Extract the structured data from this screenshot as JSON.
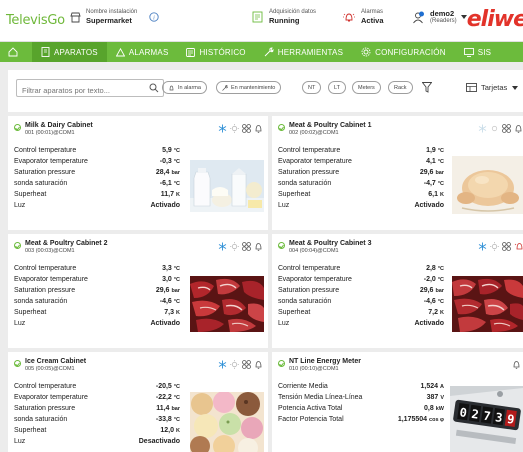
{
  "header": {
    "logo": "TelevisGo",
    "installation_label": "Nombre instalación",
    "installation_value": "Supermarket",
    "acquisition_label": "Adquisición datos",
    "acquisition_value": "Running",
    "alarms_label": "Alarmas",
    "alarms_value": "Activa",
    "user_name": "demo2",
    "user_role": "(Readers)",
    "brand": "eliwe"
  },
  "nav": {
    "home_icon": "home-icon",
    "items": [
      {
        "label": "APARATOS",
        "icon": "devices-icon",
        "active": true
      },
      {
        "label": "ALARMAS",
        "icon": "alarm-icon"
      },
      {
        "label": "HISTÓRICO",
        "icon": "history-icon"
      },
      {
        "label": "HERRAMIENTAS",
        "icon": "tools-icon"
      },
      {
        "label": "CONFIGURACIÓN",
        "icon": "gear-icon"
      },
      {
        "label": "SIS",
        "icon": "monitor-icon"
      }
    ]
  },
  "toolbar": {
    "search_placeholder": "Filtrar aparatos por texto...",
    "filters": [
      "In alarma",
      "En mantenimiento",
      "NT",
      "LT",
      "Meters",
      "Rack"
    ],
    "view_label": "Tarjetas"
  },
  "colors": {
    "accent": "#6cbb3c",
    "nav_active": "#58a42c",
    "brand": "#e2332a"
  },
  "cards": [
    {
      "title": "Milk & Dairy Cabinet",
      "id": "001 (00:01)@COM1",
      "image": "dairy",
      "rows": [
        {
          "label": "Control temperature",
          "value": "5,9",
          "unit": "°C"
        },
        {
          "label": "Evaporator temperature",
          "value": "-0,3",
          "unit": "°C"
        },
        {
          "label": "Saturation pressure",
          "value": "28,4",
          "unit": "bar"
        },
        {
          "label": "sonda saturación",
          "value": "-6,1",
          "unit": "°C"
        },
        {
          "label": "Superheat",
          "value": "11,7",
          "unit": "K"
        },
        {
          "label": "Luz",
          "value": "Activado",
          "unit": ""
        }
      ]
    },
    {
      "title": "Meat & Poultry Cabinet 1",
      "id": "002 (00:02)@COM1",
      "image": "chicken",
      "rows": [
        {
          "label": "Control temperature",
          "value": "1,9",
          "unit": "°C"
        },
        {
          "label": "Evaporator temperature",
          "value": "4,1",
          "unit": "°C"
        },
        {
          "label": "Saturation pressure",
          "value": "29,6",
          "unit": "bar"
        },
        {
          "label": "sonda saturación",
          "value": "-4,7",
          "unit": "°C"
        },
        {
          "label": "Superheat",
          "value": "6,1",
          "unit": "K"
        },
        {
          "label": "Luz",
          "value": "Activado",
          "unit": ""
        }
      ]
    },
    {
      "title": "Meat & Poultry Cabinet 2",
      "id": "003 (00:03)@COM1",
      "image": "meat",
      "rows": [
        {
          "label": "Control temperature",
          "value": "3,3",
          "unit": "°C"
        },
        {
          "label": "Evaporator temperature",
          "value": "3,0",
          "unit": "°C"
        },
        {
          "label": "Saturation pressure",
          "value": "29,6",
          "unit": "bar"
        },
        {
          "label": "sonda saturación",
          "value": "-4,6",
          "unit": "°C"
        },
        {
          "label": "Superheat",
          "value": "7,3",
          "unit": "K"
        },
        {
          "label": "Luz",
          "value": "Activado",
          "unit": ""
        }
      ]
    },
    {
      "title": "Meat & Poultry Cabinet 3",
      "id": "004 (00:04)@COM1",
      "image": "meat",
      "rows": [
        {
          "label": "Control temperature",
          "value": "2,8",
          "unit": "°C"
        },
        {
          "label": "Evaporator temperature",
          "value": "-2,0",
          "unit": "°C"
        },
        {
          "label": "Saturation pressure",
          "value": "29,6",
          "unit": "bar"
        },
        {
          "label": "sonda saturación",
          "value": "-4,6",
          "unit": "°C"
        },
        {
          "label": "Superheat",
          "value": "7,2",
          "unit": "K"
        },
        {
          "label": "Luz",
          "value": "Activado",
          "unit": ""
        }
      ]
    },
    {
      "title": "Ice Cream Cabinet",
      "id": "005 (00:05)@COM1",
      "image": "icecream",
      "rows": [
        {
          "label": "Control temperature",
          "value": "-20,5",
          "unit": "°C"
        },
        {
          "label": "Evaporator temperature",
          "value": "-22,2",
          "unit": "°C"
        },
        {
          "label": "Saturation pressure",
          "value": "11,4",
          "unit": "bar"
        },
        {
          "label": "sonda saturación",
          "value": "-33,8",
          "unit": "°C"
        },
        {
          "label": "Superheat",
          "value": "12,0",
          "unit": "K"
        },
        {
          "label": "Luz",
          "value": "Desactivado",
          "unit": ""
        }
      ]
    },
    {
      "title": "NT Line Energy Meter",
      "id": "010 (00:10)@COM1",
      "image": "meter",
      "rows": [
        {
          "label": "Corriente Media",
          "value": "1,524",
          "unit": "A"
        },
        {
          "label": "Tensión Media Línea-Línea",
          "value": "387",
          "unit": "V"
        },
        {
          "label": "Potencia Activa Total",
          "value": "0,8",
          "unit": "kW"
        },
        {
          "label": "Factor Potencia Total",
          "value": "1,175504",
          "unit": "cos φ"
        }
      ]
    }
  ]
}
